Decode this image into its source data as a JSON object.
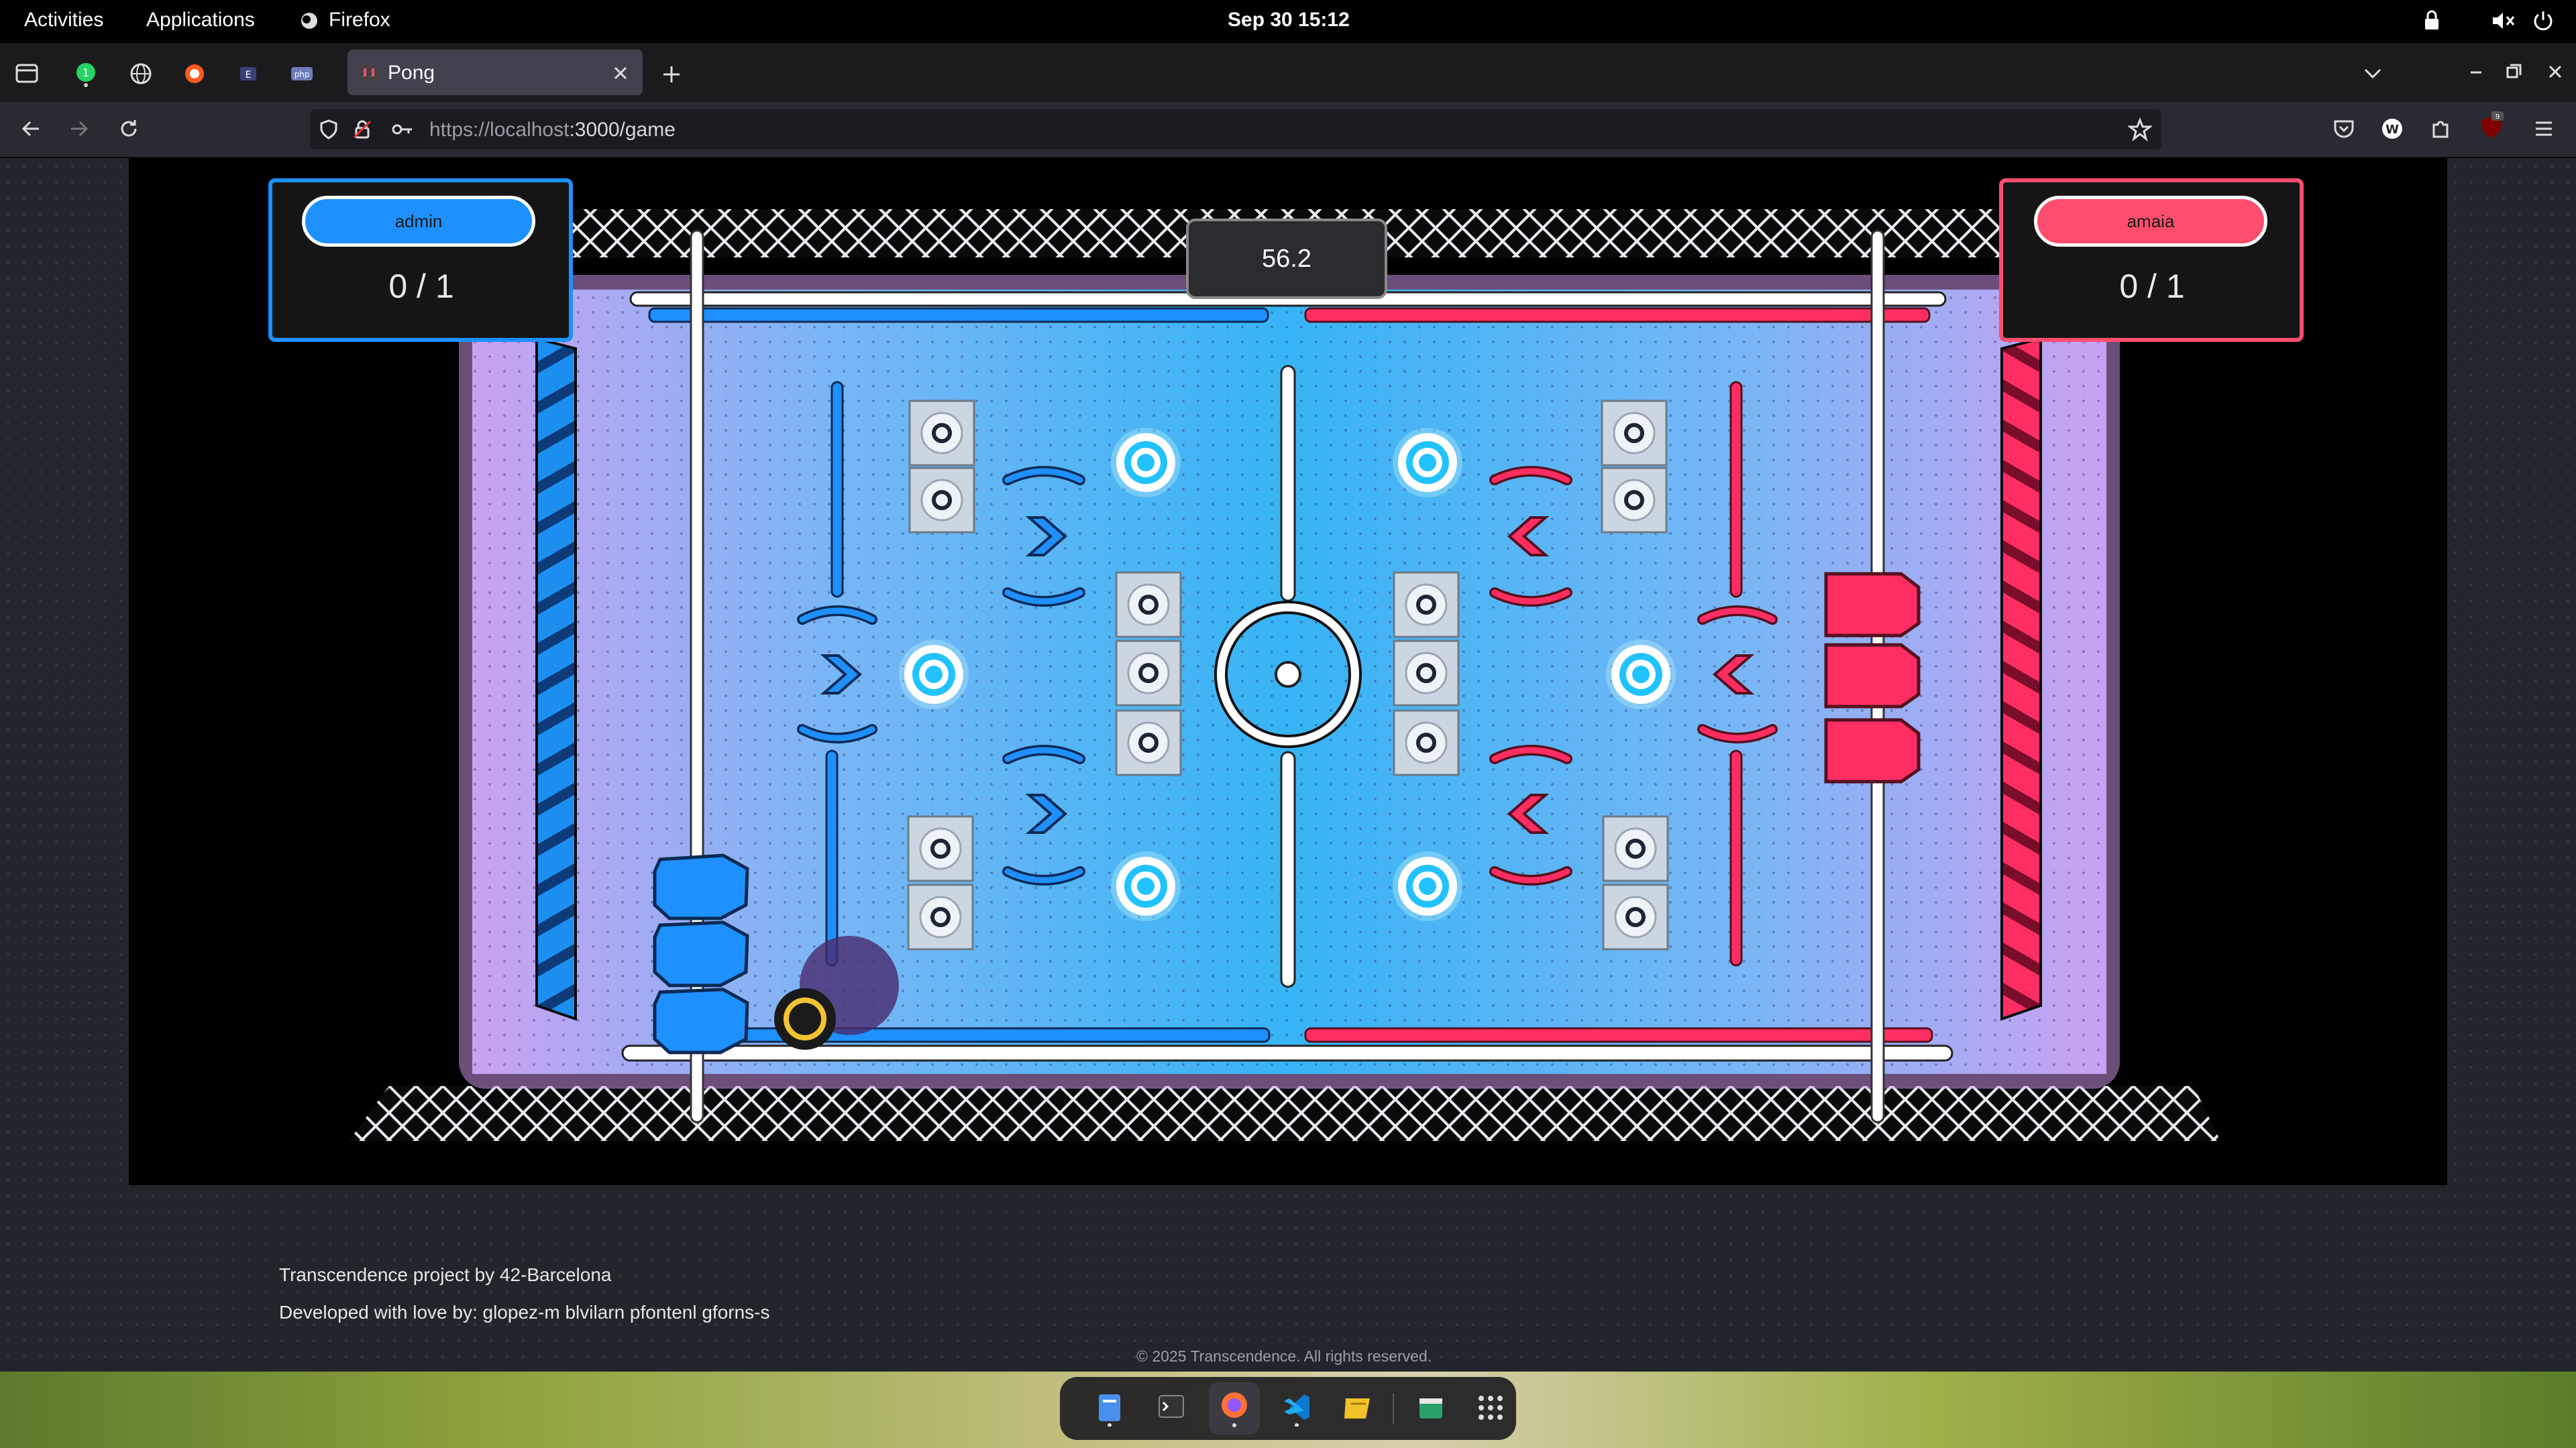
{
  "system_bar": {
    "activities": "Activities",
    "applications": "Applications",
    "app_name": "Firefox",
    "datetime": "Sep 30  15:12"
  },
  "browser": {
    "tab_title": "Pong",
    "url_host": "https://localhost",
    "url_rest": ":3000/game"
  },
  "game": {
    "timer": "56.2",
    "player_left": {
      "name": "admin",
      "score": "0 / 1",
      "color": "#1e90ff"
    },
    "player_right": {
      "name": "amaia",
      "score": "0 / 1",
      "color": "#ff4d6d"
    }
  },
  "footer": {
    "line1": "Transcendence project by 42-Barcelona",
    "line2": "Developed with love by: glopez-m blvilarn pfontenl gforns-s",
    "copyright": "© 2025 Transcendence. All rights reserved."
  },
  "icons": [
    "sidebar-icon",
    "whatsapp-icon",
    "globe-icon",
    "brave-icon",
    "tab-icon",
    "php-icon",
    "pong-favicon",
    "close-icon",
    "new-tab-icon",
    "list-tabs-icon",
    "minimize-icon",
    "restore-icon",
    "window-close-icon",
    "back-icon",
    "forward-icon",
    "reload-icon",
    "shield-icon",
    "lock-icon",
    "key-icon",
    "star-icon",
    "pocket-icon",
    "w-icon",
    "extensions-icon",
    "ublock-icon",
    "menu-icon",
    "lock-screen-icon",
    "volume-icon",
    "power-icon",
    "files-icon",
    "terminal-icon",
    "firefox-icon",
    "vscode-icon",
    "notes-icon",
    "store-icon",
    "app-grid-icon"
  ]
}
